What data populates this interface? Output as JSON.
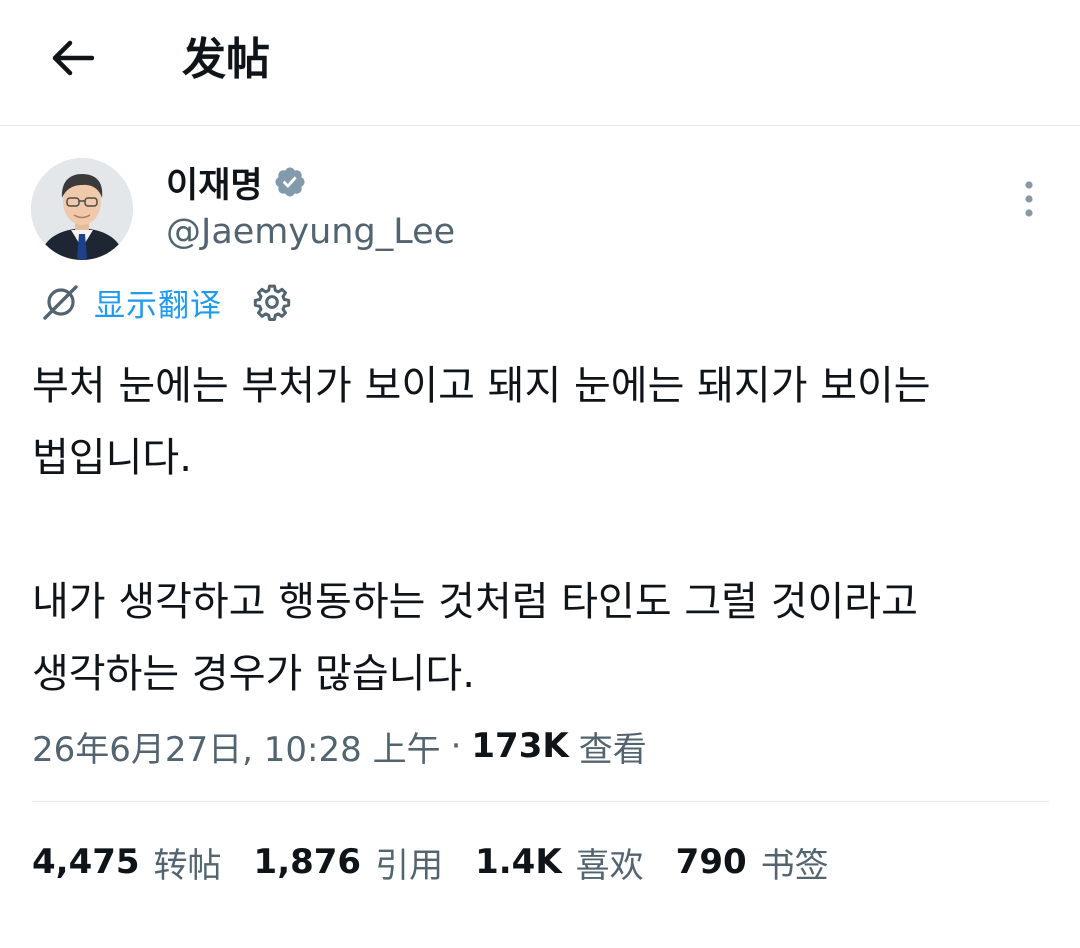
{
  "header": {
    "back_icon": "arrow-left-icon",
    "title": "发帖"
  },
  "author": {
    "name": "이재명",
    "handle": "@Jaemyung_Lee",
    "verified_icon": "verified-badge-icon",
    "verified_color": "#829aab",
    "more_icon": "vertical-dots-icon"
  },
  "translate": {
    "icon": "translate-globe-icon",
    "label": "显示翻译",
    "settings_icon": "gear-icon",
    "color": "#1d9bf0"
  },
  "tweet": {
    "paragraphs": [
      "부처 눈에는 부처가 보이고 돼지 눈에는 돼지가 보이는 법입니다.",
      "내가 생각하고 행동하는 것처럼 타인도 그럴 것이라고 생각하는 경우가 많습니다."
    ]
  },
  "meta": {
    "timestamp": "26年6月27日, 10:28 上午",
    "separator": "·",
    "views_count": "173K",
    "views_label": "查看"
  },
  "stats": {
    "retweets": {
      "value": "4,475",
      "label": "转帖"
    },
    "quotes": {
      "value": "1,876",
      "label": "引用"
    },
    "likes": {
      "value": "1.4K",
      "label": "喜欢"
    },
    "bookmarks": {
      "value": "790",
      "label": "书签"
    }
  },
  "colors": {
    "text_primary": "#0f1419",
    "text_secondary": "#536471",
    "link": "#1d9bf0",
    "divider": "#e7e9ea"
  }
}
